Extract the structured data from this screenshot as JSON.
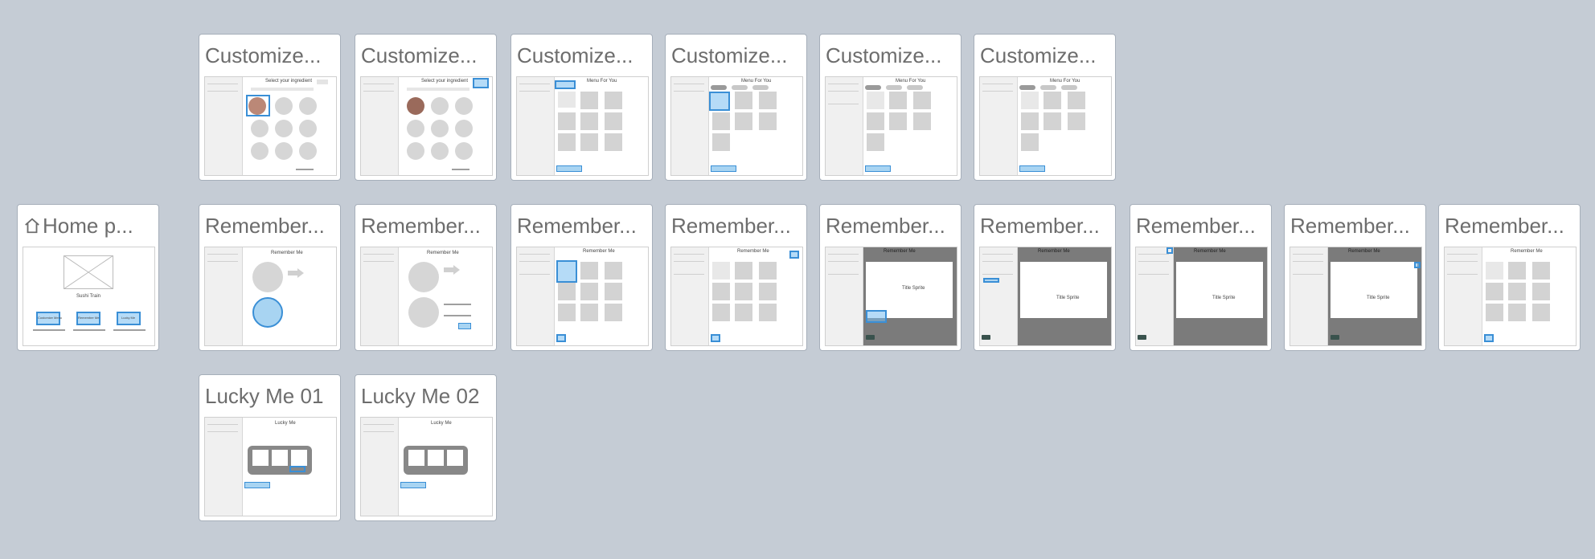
{
  "cards": {
    "home": {
      "title": "Home p...",
      "icon": "home-icon",
      "thumb_title": "Sushi Train",
      "buttons": [
        "Customize Menu",
        "Remember Me",
        "Lucky Me"
      ]
    },
    "customize1": {
      "title": "Customize...",
      "thumb_title": "Select your ingredient"
    },
    "customize2": {
      "title": "Customize...",
      "thumb_title": "Select your ingredient"
    },
    "customize3": {
      "title": "Customize...",
      "thumb_title": "Menu For You"
    },
    "customize4": {
      "title": "Customize...",
      "thumb_title": "Menu For You"
    },
    "customize5": {
      "title": "Customize...",
      "thumb_title": "Menu For You"
    },
    "customize6": {
      "title": "Customize...",
      "thumb_title": "Menu For You"
    },
    "remember1": {
      "title": "Remember...",
      "thumb_title": "Remember Me"
    },
    "remember2": {
      "title": "Remember...",
      "thumb_title": "Remember Me"
    },
    "remember3": {
      "title": "Remember...",
      "thumb_title": "Remember Me"
    },
    "remember4": {
      "title": "Remember...",
      "thumb_title": "Remember Me"
    },
    "remember5": {
      "title": "Remember...",
      "thumb_title": "Remember Me",
      "modal_text": "Title Sprite"
    },
    "remember6": {
      "title": "Remember...",
      "thumb_title": "Remember Me",
      "modal_text": "Title Sprite"
    },
    "remember7": {
      "title": "Remember...",
      "thumb_title": "Remember Me",
      "modal_text": "Title Sprite"
    },
    "remember8": {
      "title": "Remember...",
      "thumb_title": "Remember Me",
      "modal_text": "Title Sprite"
    },
    "remember9": {
      "title": "Remember...",
      "thumb_title": "Remember Me"
    },
    "lucky1": {
      "title": "Lucky Me 01",
      "thumb_title": "Lucky Me"
    },
    "lucky2": {
      "title": "Lucky Me 02",
      "thumb_title": "Lucky Me"
    }
  },
  "colors": {
    "background": "#c5ccd5",
    "highlight": "#3a8fd6",
    "card_border": "#a6afba"
  }
}
